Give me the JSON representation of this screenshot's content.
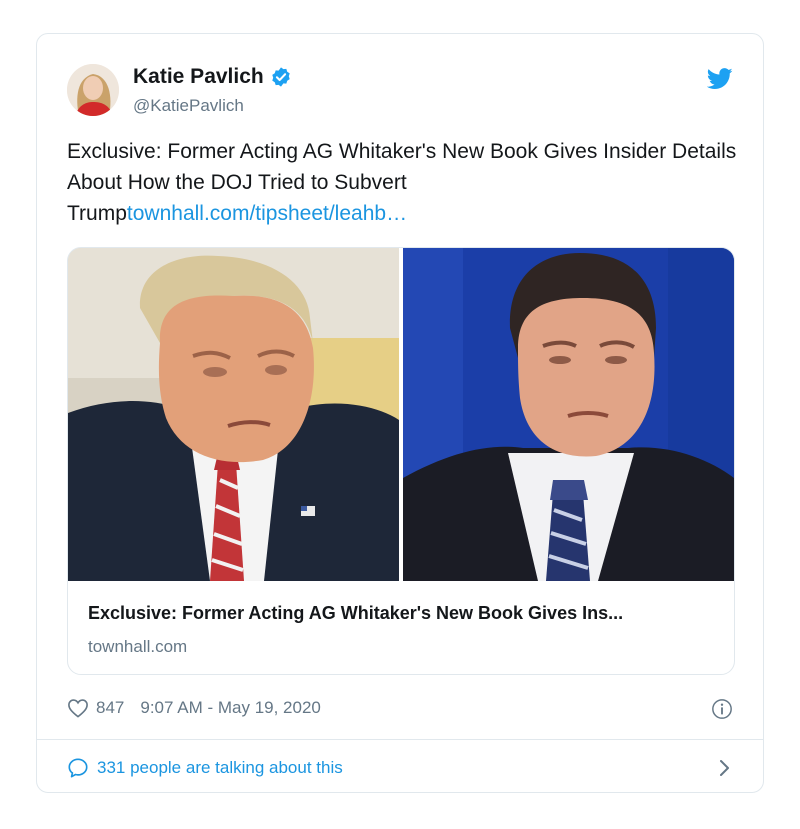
{
  "tweet": {
    "author": {
      "name": "Katie Pavlich",
      "handle": "@KatiePavlich"
    },
    "text": "Exclusive: Former Acting AG Whitaker's New Book Gives Insider Details About How the DOJ Tried to Subvert Trump",
    "link_text": "townhall.com/tipsheet/leahb…",
    "card": {
      "title": "Exclusive: Former Acting AG Whitaker's New Book Gives Ins...",
      "domain": "townhall.com"
    },
    "likes": "847",
    "timestamp": "9:07 AM - May 19, 2020",
    "conversation": "331 people are talking about this"
  },
  "colors": {
    "accent": "#1b95e0",
    "muted": "#657786",
    "border": "#e1e8ed",
    "text": "#14171a"
  },
  "icons": [
    "verified-badge-icon",
    "twitter-bird-icon",
    "heart-icon",
    "info-icon",
    "speech-bubble-icon",
    "chevron-right-icon"
  ]
}
